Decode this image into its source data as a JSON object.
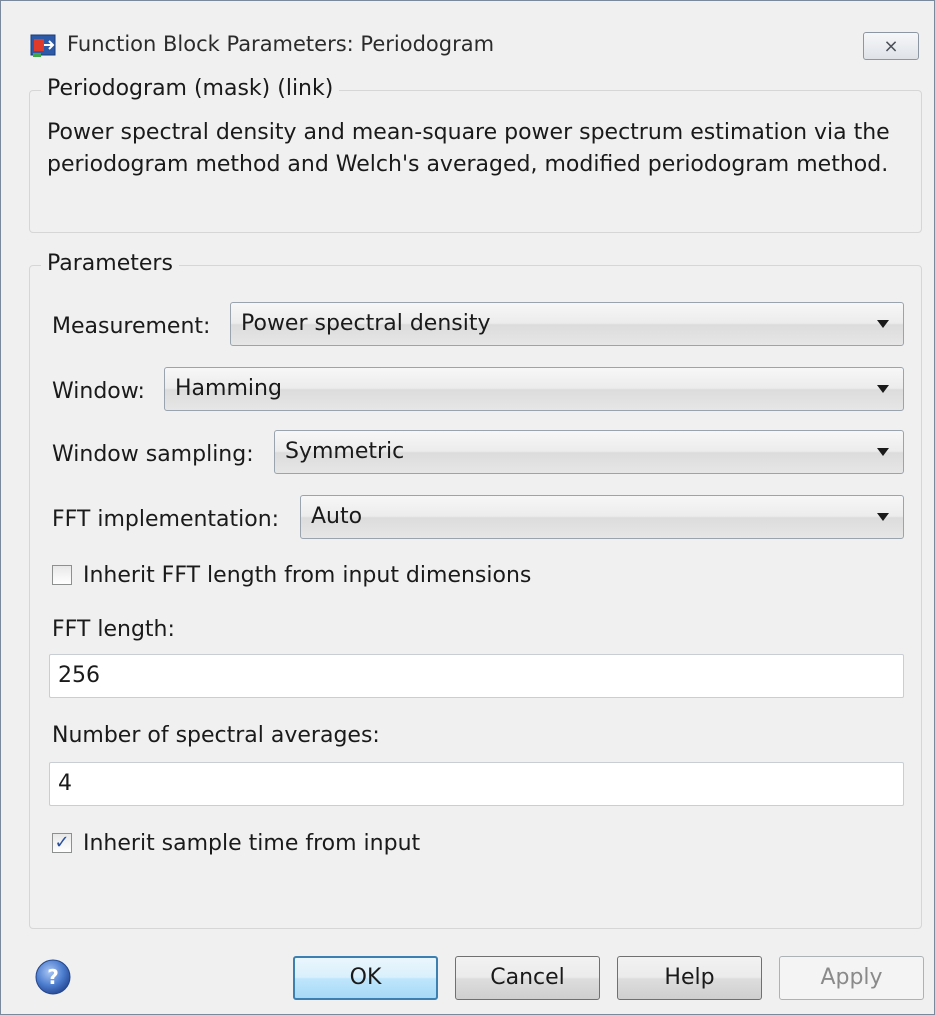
{
  "window": {
    "title": "Function Block Parameters: Periodogram",
    "close_glyph": "⨯"
  },
  "mask_group": {
    "legend": "Periodogram (mask) (link)",
    "description": "Power spectral density and mean-square power spectrum estimation via the periodogram method and Welch's averaged, modified periodogram method."
  },
  "parameters": {
    "legend": "Parameters",
    "measurement": {
      "label": "Measurement:",
      "value": "Power spectral density"
    },
    "window": {
      "label": "Window:",
      "value": "Hamming"
    },
    "window_sampling": {
      "label": "Window sampling:",
      "value": "Symmetric"
    },
    "fft_implementation": {
      "label": "FFT implementation:",
      "value": "Auto"
    },
    "inherit_fft": {
      "label": "Inherit FFT length from input dimensions",
      "checked": false
    },
    "fft_length": {
      "label": "FFT length:",
      "value": "256"
    },
    "spectral_averages": {
      "label": "Number of spectral averages:",
      "value": "4"
    },
    "inherit_sample_time": {
      "label": "Inherit sample time from input",
      "checked": true,
      "check_glyph": "✓"
    }
  },
  "buttons": {
    "ok": "OK",
    "cancel": "Cancel",
    "help": "Help",
    "apply": "Apply"
  },
  "icons": {
    "app": "simulink-block-icon",
    "help": "help-question-icon"
  },
  "colors": {
    "background": "#f0f0f0",
    "default_button_border": "#3c7fb1",
    "help_icon": "#3a63b8"
  }
}
